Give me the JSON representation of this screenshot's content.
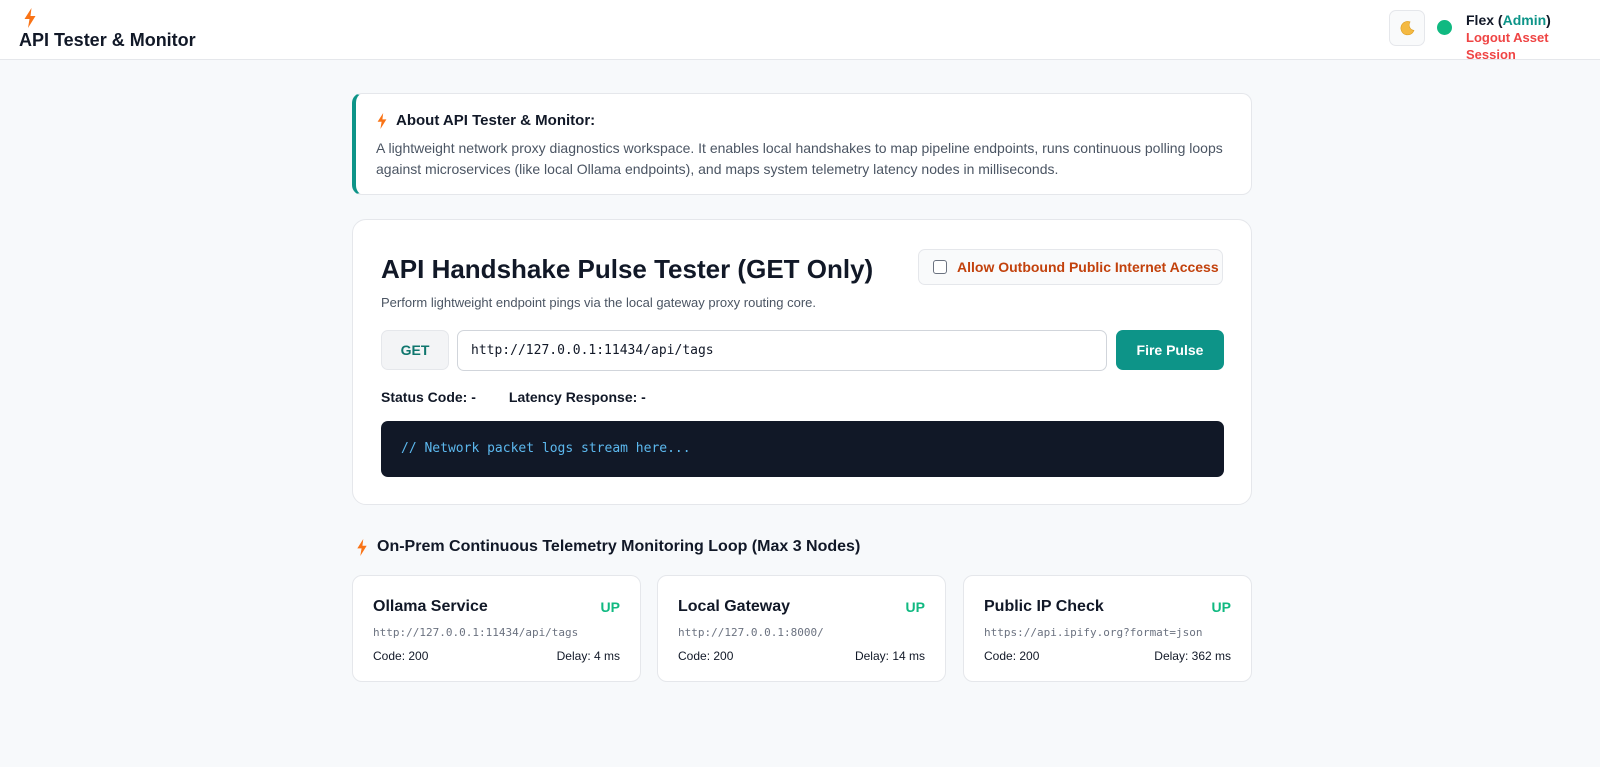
{
  "header": {
    "app_title": "API Tester & Monitor",
    "user_name": "Flex",
    "user_open_paren": "(",
    "user_role": "Admin",
    "user_close_paren": ")",
    "logout_label": "Logout Asset Session",
    "status_color": "#10b981",
    "icons": {
      "brand": "bolt-icon",
      "theme": "moon-icon"
    }
  },
  "about": {
    "title": "About API Tester & Monitor:",
    "description": "A lightweight network proxy diagnostics workspace. It enables local handshakes to map pipeline endpoints, runs continuous polling loops against microservices (like local Ollama endpoints), and maps system telemetry latency nodes in milliseconds."
  },
  "tester": {
    "title": "API Handshake Pulse Tester (GET Only)",
    "subtitle": "Perform lightweight endpoint pings via the local gateway proxy routing core.",
    "public_access_label": "Allow Outbound Public Internet Access",
    "public_access_checked": false,
    "method": "GET",
    "url_value": "http://127.0.0.1:11434/api/tags",
    "fire_label": "Fire Pulse",
    "status_code_label": "Status Code: -",
    "latency_label": "Latency Response: -",
    "console_text": "// Network packet logs stream here..."
  },
  "monitor": {
    "title": "On-Prem Continuous Telemetry Monitoring Loop (Max 3 Nodes)",
    "nodes": [
      {
        "name": "Ollama Service",
        "status": "UP",
        "url": "http://127.0.0.1:11434/api/tags",
        "code": "Code: 200",
        "delay": "Delay: 4 ms"
      },
      {
        "name": "Local Gateway",
        "status": "UP",
        "url": "http://127.0.0.1:8000/",
        "code": "Code: 200",
        "delay": "Delay: 14 ms"
      },
      {
        "name": "Public IP Check",
        "status": "UP",
        "url": "https://api.ipify.org?format=json",
        "code": "Code: 200",
        "delay": "Delay: 362 ms"
      }
    ]
  },
  "colors": {
    "accent": "#0d9488",
    "bolt": "#f97316",
    "up": "#10b981",
    "logout": "#ef4444",
    "warning_label": "#c2410c",
    "console_bg": "#111827",
    "console_text": "#5cb8ee"
  }
}
